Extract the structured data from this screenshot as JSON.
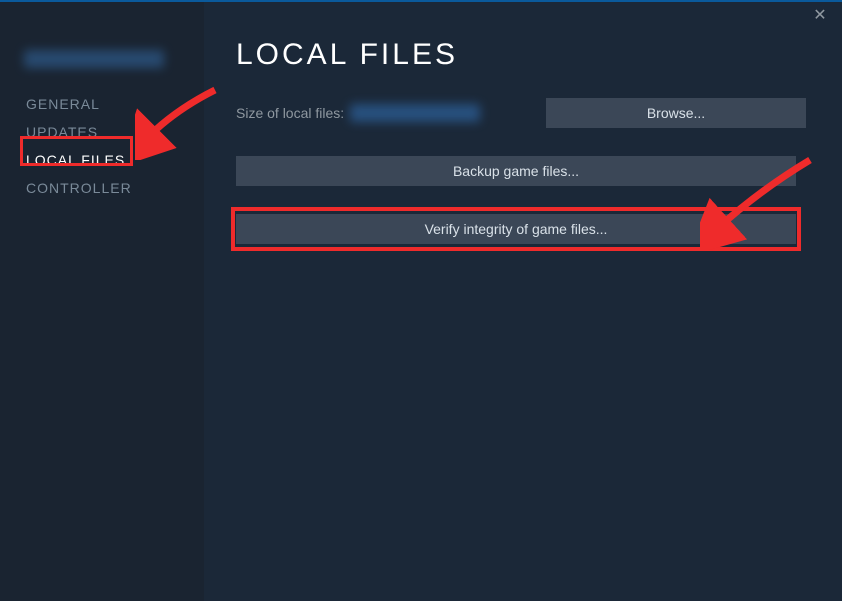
{
  "sidebar": {
    "items": [
      {
        "label": "GENERAL"
      },
      {
        "label": "UPDATES"
      },
      {
        "label": "LOCAL FILES"
      },
      {
        "label": "CONTROLLER"
      }
    ]
  },
  "main": {
    "heading": "LOCAL FILES",
    "size_label": "Size of local files:",
    "browse_label": "Browse...",
    "backup_label": "Backup game files...",
    "verify_label": "Verify integrity of game files..."
  },
  "close_glyph": "✕"
}
